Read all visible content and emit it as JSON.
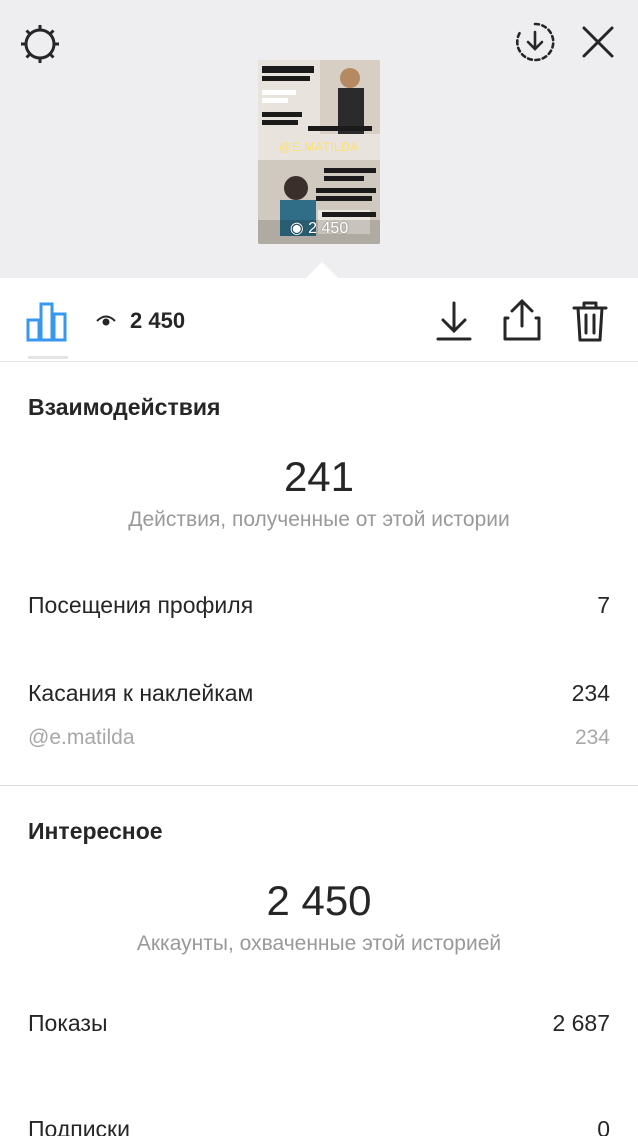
{
  "story": {
    "sticker_handle": "@E.MATILDA",
    "views_overlay": "2 450"
  },
  "toolbar": {
    "views": "2 450"
  },
  "interactions": {
    "title": "Взаимодействия",
    "total": "241",
    "caption": "Действия, полученные от этой истории",
    "rows": [
      {
        "label": "Посещения профиля",
        "value": "7"
      },
      {
        "label": "Касания к наклейкам",
        "value": "234"
      }
    ],
    "sub_rows": [
      {
        "label": "@e.matilda",
        "value": "234"
      }
    ]
  },
  "discovery": {
    "title": "Интересное",
    "total": "2 450",
    "caption": "Аккаунты, охваченные этой историей",
    "rows": [
      {
        "label": "Показы",
        "value": "2 687"
      },
      {
        "label": "Подписки",
        "value": "0"
      }
    ]
  },
  "colors": {
    "accent_blue": "#3897f0",
    "top_background": "#eeeef0",
    "muted_text": "#999999"
  },
  "icons": {
    "settings": "settings-gear-icon",
    "download_circle": "download-circle-icon",
    "close": "close-icon",
    "stats": "bar-chart-icon",
    "eye": "eye-icon",
    "download": "download-icon",
    "share": "share-icon",
    "delete": "trash-icon"
  }
}
